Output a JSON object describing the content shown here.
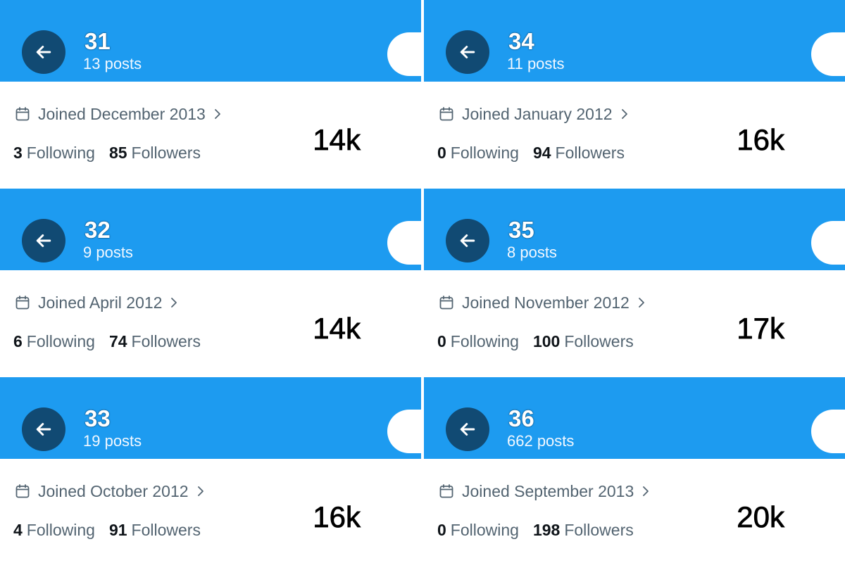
{
  "cards": [
    {
      "name": "31",
      "posts": "13 posts",
      "joined": "Joined December 2013",
      "following": "3",
      "following_label": "Following",
      "followers": "85",
      "followers_label": "Followers",
      "overlay": "14k"
    },
    {
      "name": "34",
      "posts": "11 posts",
      "joined": "Joined January 2012",
      "following": "0",
      "following_label": "Following",
      "followers": "94",
      "followers_label": "Followers",
      "overlay": "16k"
    },
    {
      "name": "32",
      "posts": "9 posts",
      "joined": "Joined April 2012",
      "following": "6",
      "following_label": "Following",
      "followers": "74",
      "followers_label": "Followers",
      "overlay": "14k"
    },
    {
      "name": "35",
      "posts": "8 posts",
      "joined": "Joined November 2012",
      "following": "0",
      "following_label": "Following",
      "followers": "100",
      "followers_label": "Followers",
      "overlay": "17k"
    },
    {
      "name": "33",
      "posts": "19 posts",
      "joined": "Joined October 2012",
      "following": "4",
      "following_label": "Following",
      "followers": "91",
      "followers_label": "Followers",
      "overlay": "16k"
    },
    {
      "name": "36",
      "posts": "662 posts",
      "joined": "Joined September 2013",
      "following": "0",
      "following_label": "Following",
      "followers": "198",
      "followers_label": "Followers",
      "overlay": "20k"
    }
  ],
  "icons": {
    "back": "arrow-left-icon",
    "calendar": "calendar-icon",
    "chevron": "chevron-right-icon"
  },
  "colors": {
    "header": "#1d9bf0",
    "back_button": "#114a73",
    "secondary_text": "#536471",
    "primary_text": "#0f1419"
  }
}
